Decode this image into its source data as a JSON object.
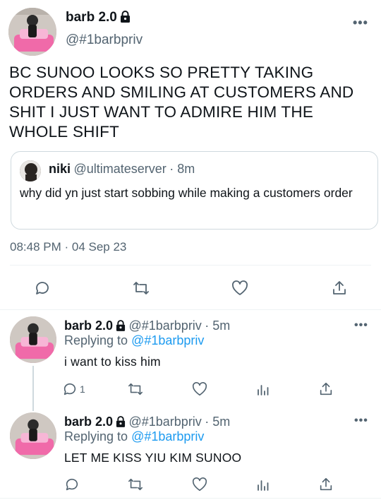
{
  "main_tweet": {
    "name": "barb 2.0",
    "handle": "@#1barbpriv",
    "text": "BC SUNOO LOOKS SO PRETTY TAKING ORDERS AND SMILING AT CUSTOMERS AND SHIT I JUST WANT TO ADMIRE HIM THE WHOLE SHIFT",
    "quoted": {
      "name": "niki",
      "handle": "@ultimateserver",
      "time": "· 8m",
      "text": "why did yn just start sobbing while making a customers order"
    },
    "timestamp": "08:48 PM · 04 Sep 23",
    "actions": [
      "reply-icon",
      "retweet-icon",
      "like-icon",
      "share-icon"
    ]
  },
  "replies": [
    {
      "name": "barb 2.0",
      "handle": "@#1barbpriv",
      "time": "· 5m",
      "replying_label": "Replying to",
      "replying_to": "@#1barbpriv",
      "text": "i want to kiss him",
      "reply_count": "1"
    },
    {
      "name": "barb 2.0",
      "handle": "@#1barbpriv",
      "time": "· 5m",
      "replying_label": "Replying to",
      "replying_to": "@#1barbpriv",
      "text": "LET ME KISS YIU KIM SUNOO",
      "reply_count": ""
    }
  ],
  "more_label": "•••",
  "colors": {
    "accent": "#1d9bf0",
    "secondary_text": "#536471",
    "primary_text": "#0f1419",
    "border": "#cfd9de"
  }
}
